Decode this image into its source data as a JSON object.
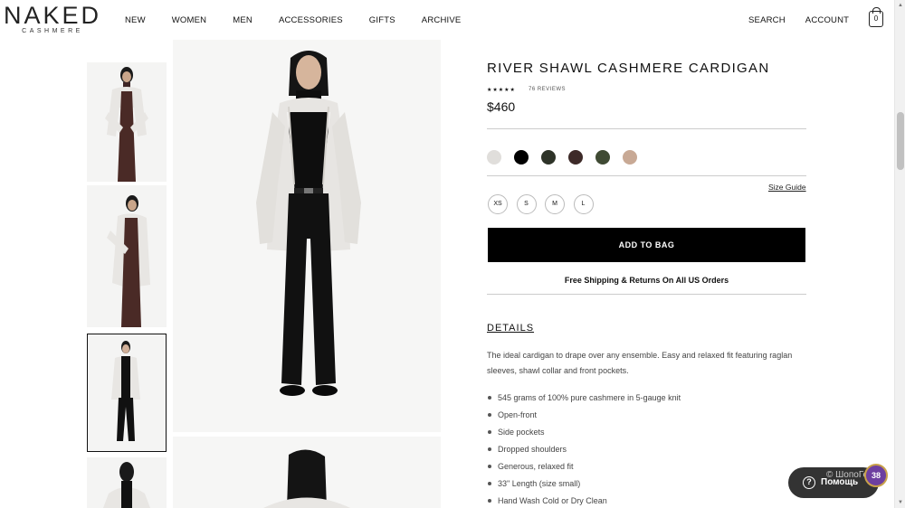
{
  "brand": {
    "name": "NAKED",
    "sub": "CASHMERE"
  },
  "nav": {
    "items": [
      "NEW",
      "WOMEN",
      "MEN",
      "ACCESSORIES",
      "GIFTS",
      "ARCHIVE"
    ]
  },
  "right_nav": {
    "search": "SEARCH",
    "account": "ACCOUNT",
    "bag_count": "0"
  },
  "product": {
    "title": "RIVER SHAWL CASHMERE CARDIGAN",
    "stars": "★★★★★",
    "reviews": "76 REVIEWS",
    "price": "$460",
    "colors": [
      "#e0dedb",
      "#000000",
      "#2e3328",
      "#3d2a28",
      "#3f4a33",
      "#c8a995"
    ],
    "size_guide": "Size Guide",
    "sizes": [
      "XS",
      "S",
      "M",
      "L"
    ],
    "add_to_bag": "ADD TO BAG",
    "shipping": "Free Shipping & Returns On All US Orders"
  },
  "details": {
    "heading": "DETAILS",
    "description": "The ideal cardigan to drape over any ensemble. Easy and relaxed fit featuring raglan sleeves, shawl collar and front pockets.",
    "bullets": [
      "545 grams of 100% pure cashmere in 5-gauge knit",
      "Open-front",
      "Side pockets",
      "Dropped shoulders",
      "Generous, relaxed fit",
      "33\" Length (size small)",
      "Hand Wash Cold or Dry Clean"
    ]
  },
  "help": {
    "label": "Помощь",
    "watermark": "© ШопоГол",
    "badge": "38"
  }
}
